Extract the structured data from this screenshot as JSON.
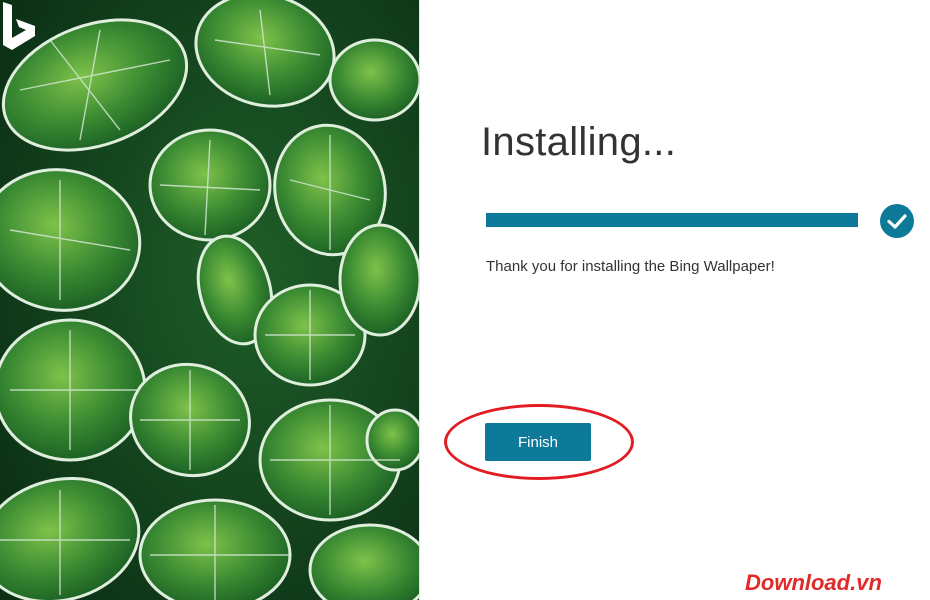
{
  "installer": {
    "title": "Installing...",
    "progress_percent": 100,
    "message": "Thank you for installing the Bing Wallpaper!",
    "finish_label": "Finish"
  },
  "watermark": {
    "text": "Download.vn"
  },
  "colors": {
    "accent": "#0e7a99",
    "highlight": "#e31b23",
    "leaf": "#3e8a35"
  },
  "icons": {
    "check": "check-icon",
    "logo": "bing-logo-icon"
  }
}
